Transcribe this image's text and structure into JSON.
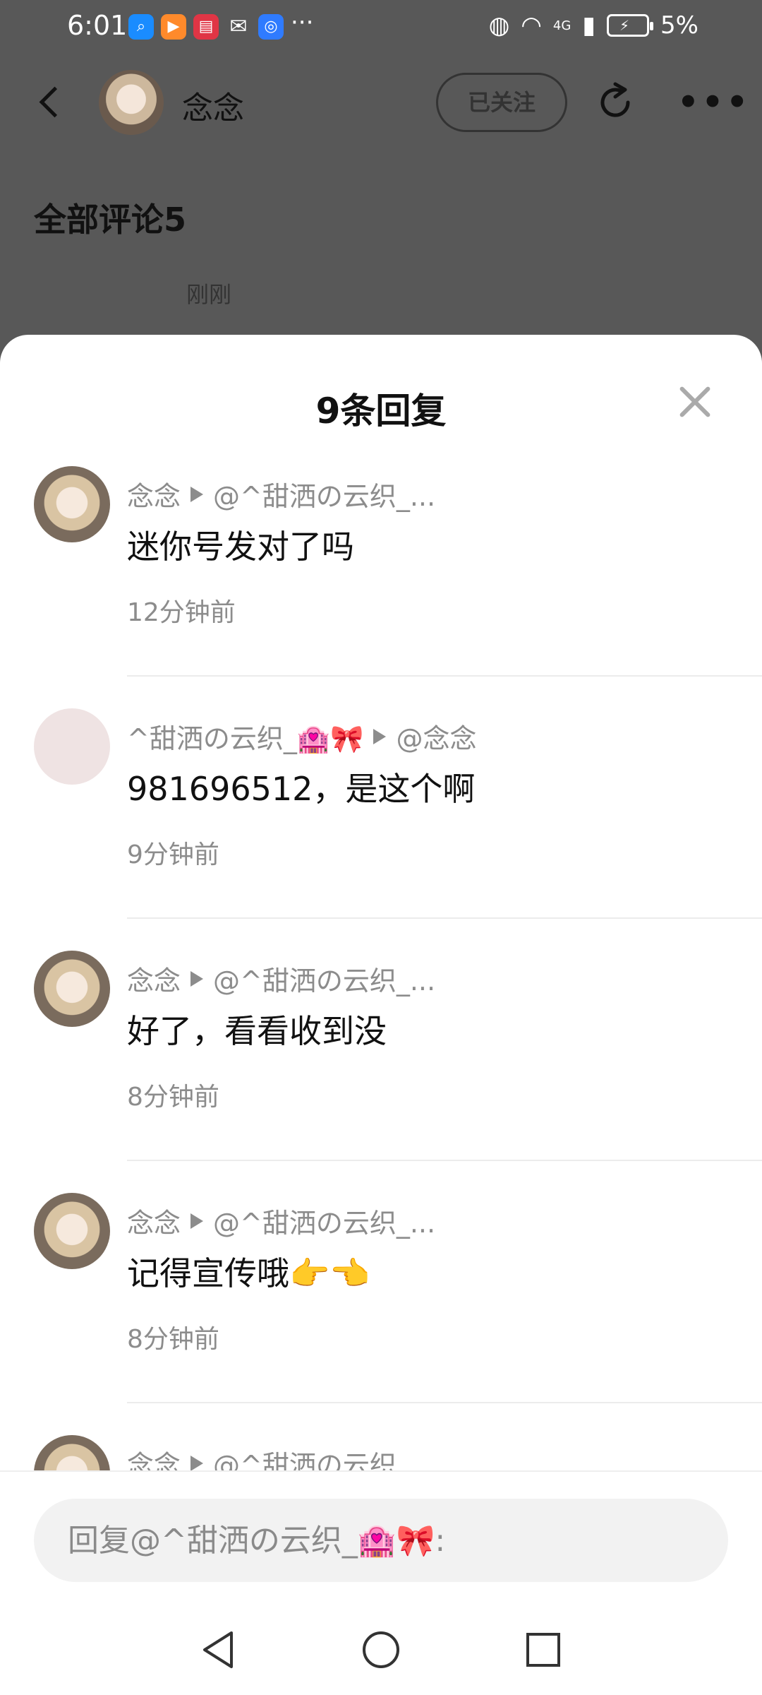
{
  "status_bar": {
    "time": "6:01",
    "more_dots": "···",
    "network": "4G",
    "battery": "5%"
  },
  "header": {
    "username": "念念",
    "follow_label": "已关注"
  },
  "background": {
    "all_comments": "全部评论5",
    "timestamp": "刚刚"
  },
  "sheet": {
    "title": "9条回复",
    "replies": [
      {
        "author": "念念",
        "target": "@^甜洒の云织_...",
        "text": "迷你号发对了吗",
        "time": "12分钟前",
        "avatar": "anime-girl"
      },
      {
        "author": "^甜洒の云织_🏩🎀",
        "target": "@念念",
        "text": "981696512，是这个啊",
        "time": "9分钟前",
        "avatar": "plain-pink"
      },
      {
        "author": "念念",
        "target": "@^甜洒の云织_...",
        "text": "好了，看看收到没",
        "time": "8分钟前",
        "avatar": "anime-girl"
      },
      {
        "author": "念念",
        "target": "@^甜洒の云织_...",
        "text": "记得宣传哦👉👈",
        "time": "8分钟前",
        "avatar": "anime-girl"
      },
      {
        "author": "念念",
        "target": "@^甜洒の云织",
        "text": "",
        "time": "",
        "avatar": "anime-girl"
      }
    ]
  },
  "footer": {
    "reply_placeholder": "回复@^甜洒の云织_🏩🎀:"
  }
}
